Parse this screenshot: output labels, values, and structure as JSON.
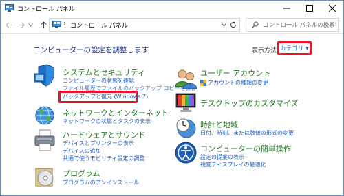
{
  "window": {
    "title": "コントロール パネル",
    "controls": {
      "minimize": "minimize",
      "maximize": "maximize",
      "close": "close"
    }
  },
  "nav": {
    "address_text": "コントロール パネル",
    "search_placeholder": "コントロール パネルの検索"
  },
  "main": {
    "heading": "コンピューターの設定を調整します",
    "view_by_label": "表示方法:",
    "view_by_value": "カテゴリ"
  },
  "categories_left": [
    {
      "title": "システムとセキュリティ",
      "links": [
        "コンピューターの状態を確認",
        "ファイル履歴でファイルのバックアップ コピーを保存",
        "バックアップと復元 (Windows 7)"
      ]
    },
    {
      "title": "ネットワークとインターネット",
      "links": [
        "ネットワークの状態とタスクの表示"
      ]
    },
    {
      "title": "ハードウェアとサウンド",
      "links": [
        "デバイスとプリンターの表示",
        "デバイスの追加",
        "共通で使うモビリティ設定の調整"
      ]
    },
    {
      "title": "プログラム",
      "links": [
        "プログラムのアンインストール"
      ]
    }
  ],
  "categories_right": [
    {
      "title": "ユーザー アカウント",
      "links": [
        "アカウントの種類の変更"
      ]
    },
    {
      "title": "デスクトップのカスタマイズ",
      "links": []
    },
    {
      "title": "時計と地域",
      "links": [
        "日付、時刻、または数値の形式の変更"
      ]
    },
    {
      "title": "コンピューターの簡単操作",
      "links": [
        "設定の提案の表示",
        "視覚ディスプレイの最適化"
      ]
    }
  ],
  "colors": {
    "category_title": "#1b7b1e",
    "link": "#1e5bbf",
    "heading": "#1e3287",
    "highlight": "#e8142a"
  }
}
